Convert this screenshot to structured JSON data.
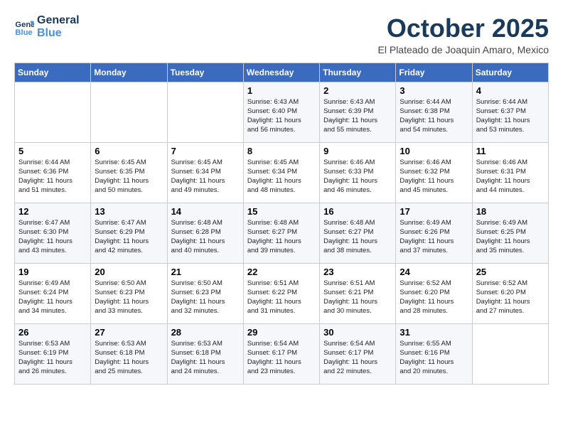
{
  "header": {
    "logo_line1": "General",
    "logo_line2": "Blue",
    "month": "October 2025",
    "location": "El Plateado de Joaquin Amaro, Mexico"
  },
  "days_of_week": [
    "Sunday",
    "Monday",
    "Tuesday",
    "Wednesday",
    "Thursday",
    "Friday",
    "Saturday"
  ],
  "weeks": [
    [
      {
        "day": "",
        "info": ""
      },
      {
        "day": "",
        "info": ""
      },
      {
        "day": "",
        "info": ""
      },
      {
        "day": "1",
        "info": "Sunrise: 6:43 AM\nSunset: 6:40 PM\nDaylight: 11 hours\nand 56 minutes."
      },
      {
        "day": "2",
        "info": "Sunrise: 6:43 AM\nSunset: 6:39 PM\nDaylight: 11 hours\nand 55 minutes."
      },
      {
        "day": "3",
        "info": "Sunrise: 6:44 AM\nSunset: 6:38 PM\nDaylight: 11 hours\nand 54 minutes."
      },
      {
        "day": "4",
        "info": "Sunrise: 6:44 AM\nSunset: 6:37 PM\nDaylight: 11 hours\nand 53 minutes."
      }
    ],
    [
      {
        "day": "5",
        "info": "Sunrise: 6:44 AM\nSunset: 6:36 PM\nDaylight: 11 hours\nand 51 minutes."
      },
      {
        "day": "6",
        "info": "Sunrise: 6:45 AM\nSunset: 6:35 PM\nDaylight: 11 hours\nand 50 minutes."
      },
      {
        "day": "7",
        "info": "Sunrise: 6:45 AM\nSunset: 6:34 PM\nDaylight: 11 hours\nand 49 minutes."
      },
      {
        "day": "8",
        "info": "Sunrise: 6:45 AM\nSunset: 6:34 PM\nDaylight: 11 hours\nand 48 minutes."
      },
      {
        "day": "9",
        "info": "Sunrise: 6:46 AM\nSunset: 6:33 PM\nDaylight: 11 hours\nand 46 minutes."
      },
      {
        "day": "10",
        "info": "Sunrise: 6:46 AM\nSunset: 6:32 PM\nDaylight: 11 hours\nand 45 minutes."
      },
      {
        "day": "11",
        "info": "Sunrise: 6:46 AM\nSunset: 6:31 PM\nDaylight: 11 hours\nand 44 minutes."
      }
    ],
    [
      {
        "day": "12",
        "info": "Sunrise: 6:47 AM\nSunset: 6:30 PM\nDaylight: 11 hours\nand 43 minutes."
      },
      {
        "day": "13",
        "info": "Sunrise: 6:47 AM\nSunset: 6:29 PM\nDaylight: 11 hours\nand 42 minutes."
      },
      {
        "day": "14",
        "info": "Sunrise: 6:48 AM\nSunset: 6:28 PM\nDaylight: 11 hours\nand 40 minutes."
      },
      {
        "day": "15",
        "info": "Sunrise: 6:48 AM\nSunset: 6:27 PM\nDaylight: 11 hours\nand 39 minutes."
      },
      {
        "day": "16",
        "info": "Sunrise: 6:48 AM\nSunset: 6:27 PM\nDaylight: 11 hours\nand 38 minutes."
      },
      {
        "day": "17",
        "info": "Sunrise: 6:49 AM\nSunset: 6:26 PM\nDaylight: 11 hours\nand 37 minutes."
      },
      {
        "day": "18",
        "info": "Sunrise: 6:49 AM\nSunset: 6:25 PM\nDaylight: 11 hours\nand 35 minutes."
      }
    ],
    [
      {
        "day": "19",
        "info": "Sunrise: 6:49 AM\nSunset: 6:24 PM\nDaylight: 11 hours\nand 34 minutes."
      },
      {
        "day": "20",
        "info": "Sunrise: 6:50 AM\nSunset: 6:23 PM\nDaylight: 11 hours\nand 33 minutes."
      },
      {
        "day": "21",
        "info": "Sunrise: 6:50 AM\nSunset: 6:23 PM\nDaylight: 11 hours\nand 32 minutes."
      },
      {
        "day": "22",
        "info": "Sunrise: 6:51 AM\nSunset: 6:22 PM\nDaylight: 11 hours\nand 31 minutes."
      },
      {
        "day": "23",
        "info": "Sunrise: 6:51 AM\nSunset: 6:21 PM\nDaylight: 11 hours\nand 30 minutes."
      },
      {
        "day": "24",
        "info": "Sunrise: 6:52 AM\nSunset: 6:20 PM\nDaylight: 11 hours\nand 28 minutes."
      },
      {
        "day": "25",
        "info": "Sunrise: 6:52 AM\nSunset: 6:20 PM\nDaylight: 11 hours\nand 27 minutes."
      }
    ],
    [
      {
        "day": "26",
        "info": "Sunrise: 6:53 AM\nSunset: 6:19 PM\nDaylight: 11 hours\nand 26 minutes."
      },
      {
        "day": "27",
        "info": "Sunrise: 6:53 AM\nSunset: 6:18 PM\nDaylight: 11 hours\nand 25 minutes."
      },
      {
        "day": "28",
        "info": "Sunrise: 6:53 AM\nSunset: 6:18 PM\nDaylight: 11 hours\nand 24 minutes."
      },
      {
        "day": "29",
        "info": "Sunrise: 6:54 AM\nSunset: 6:17 PM\nDaylight: 11 hours\nand 23 minutes."
      },
      {
        "day": "30",
        "info": "Sunrise: 6:54 AM\nSunset: 6:17 PM\nDaylight: 11 hours\nand 22 minutes."
      },
      {
        "day": "31",
        "info": "Sunrise: 6:55 AM\nSunset: 6:16 PM\nDaylight: 11 hours\nand 20 minutes."
      },
      {
        "day": "",
        "info": ""
      }
    ]
  ]
}
